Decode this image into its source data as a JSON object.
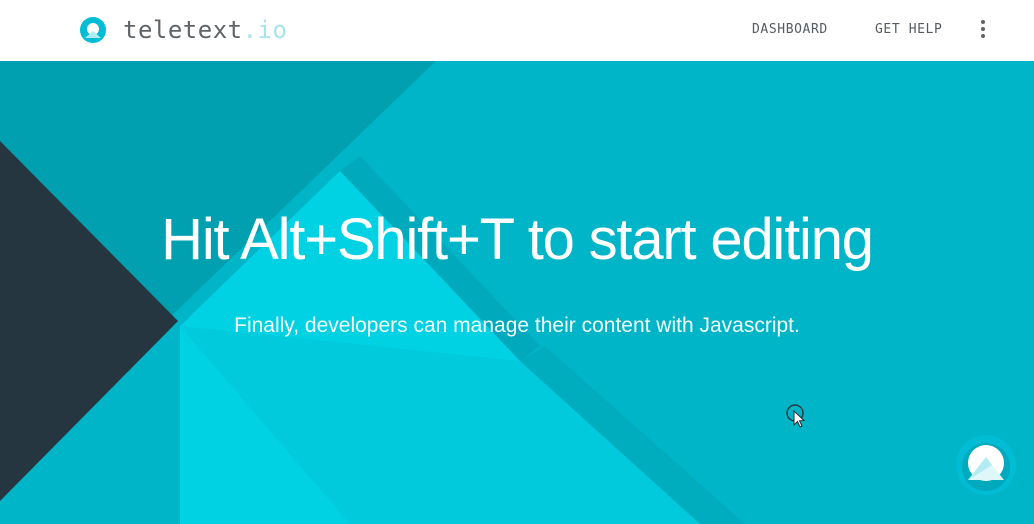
{
  "app": {
    "brand_name": "teletext",
    "brand_tld": ".io",
    "logo_icon": "teletext-logo-icon"
  },
  "nav": {
    "items": [
      {
        "label": "DASHBOARD"
      },
      {
        "label": "GET HELP"
      }
    ],
    "more_icon": "vertical-dots-icon"
  },
  "hero": {
    "title": "Hit Alt+Shift+T to start editing",
    "subtitle": "Finally, developers can manage their content with Javascript."
  },
  "fab": {
    "icon": "teletext-mountain-icon"
  },
  "colors": {
    "hero_background": "#00b5c7",
    "accent_light": "#00cbdd",
    "dark_triangle": "#263640",
    "brand_text": "#5f6468",
    "brand_tld": "#a8e2ea",
    "navbar_background": "#ffffff"
  }
}
